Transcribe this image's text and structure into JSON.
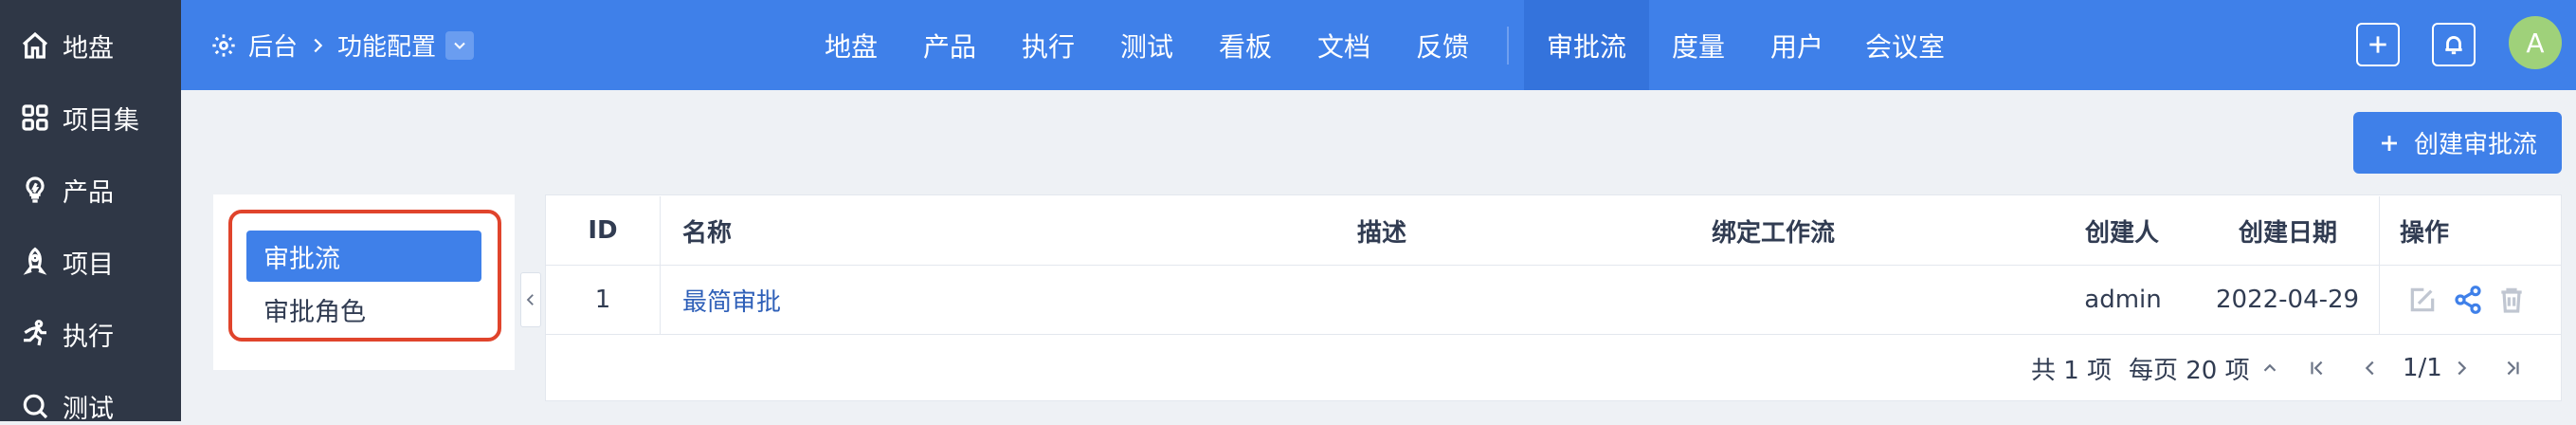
{
  "sidebar": {
    "items": [
      {
        "label": "地盘",
        "icon": "home-icon"
      },
      {
        "label": "项目集",
        "icon": "grid-icon"
      },
      {
        "label": "产品",
        "icon": "lightbulb-icon"
      },
      {
        "label": "项目",
        "icon": "rocket-icon"
      },
      {
        "label": "执行",
        "icon": "run-icon"
      },
      {
        "label": "测试",
        "icon": "search-icon"
      }
    ]
  },
  "header": {
    "breadcrumb": {
      "root": "后台",
      "current": "功能配置"
    },
    "nav": [
      "地盘",
      "产品",
      "执行",
      "测试",
      "看板",
      "文档",
      "反馈",
      "审批流",
      "度量",
      "用户",
      "会议室"
    ],
    "active_nav": "审批流",
    "avatar": "A"
  },
  "toolbar": {
    "create_label": "创建审批流"
  },
  "left_menu": {
    "items": [
      "审批流",
      "审批角色"
    ],
    "active": "审批流"
  },
  "table": {
    "columns": {
      "id": "ID",
      "name": "名称",
      "desc": "描述",
      "workflow": "绑定工作流",
      "creator": "创建人",
      "date": "创建日期",
      "actions": "操作"
    },
    "rows": [
      {
        "id": "1",
        "name": "最简审批",
        "desc": "",
        "workflow": "",
        "creator": "admin",
        "date": "2022-04-29"
      }
    ]
  },
  "pager": {
    "total": "共 1 项",
    "per_page": "每页 20 项",
    "page": "1/1"
  },
  "colors": {
    "brand": "#3f80e9",
    "sidebar": "#2f3746",
    "highlight": "#e0442c"
  }
}
